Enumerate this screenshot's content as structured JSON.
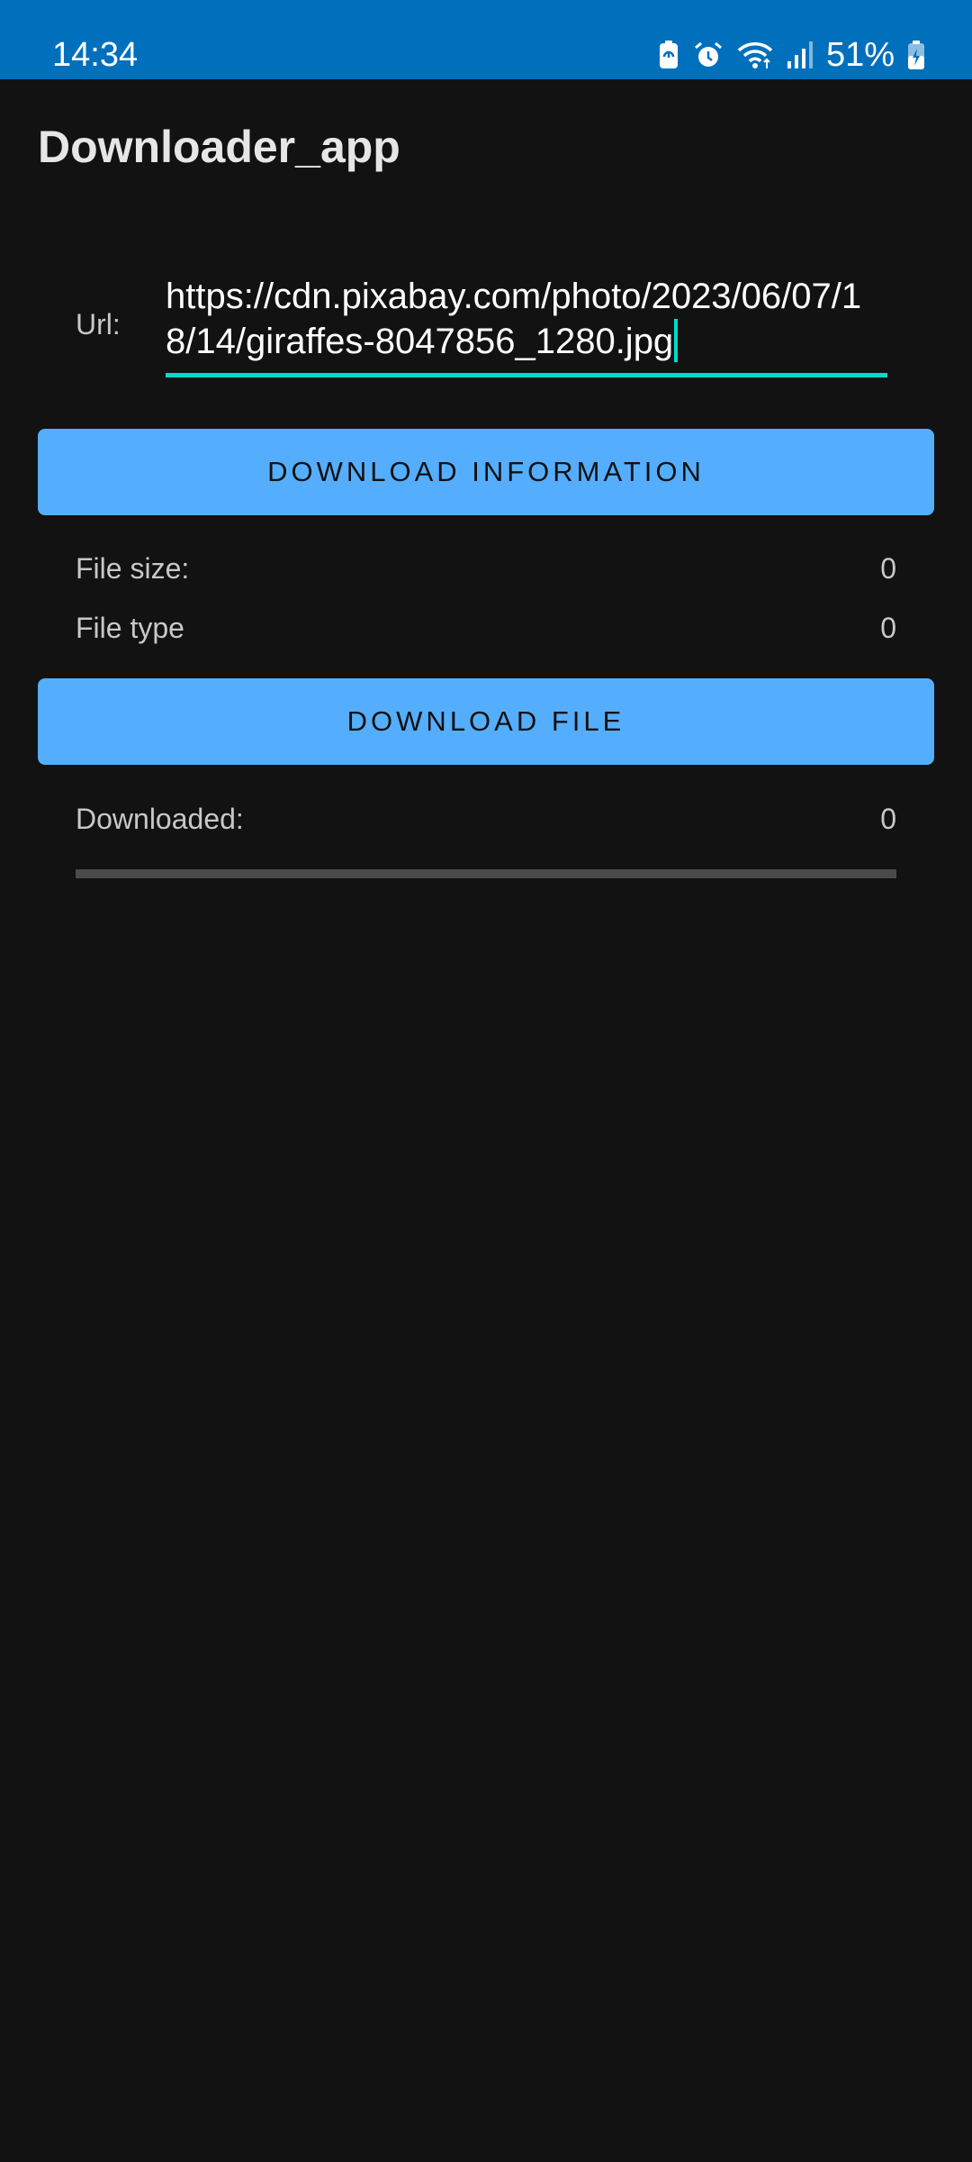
{
  "status_bar": {
    "time": "14:34",
    "battery_percent": "51%",
    "icons": [
      "battery-saver-icon",
      "alarm-icon",
      "wifi-icon",
      "signal-icon",
      "battery-charging-icon"
    ],
    "background_color": "#0070BD"
  },
  "app": {
    "title": "Downloader_app"
  },
  "url_field": {
    "label": "Url:",
    "value": "https://cdn.pixabay.com/photo/2023/06/07/18/14/giraffes-8047856_1280.jpg"
  },
  "buttons": {
    "download_information": "DOWNLOAD INFORMATION",
    "download_file": "DOWNLOAD FILE",
    "color": "#55AEFD"
  },
  "file_info": {
    "size_label": "File size:",
    "size_value": "0",
    "type_label": "File type",
    "type_value": "0"
  },
  "download_status": {
    "downloaded_label": "Downloaded:",
    "downloaded_value": "0",
    "progress_fraction": 0
  },
  "colors": {
    "accent": "#03DAC5",
    "background": "#121212"
  }
}
